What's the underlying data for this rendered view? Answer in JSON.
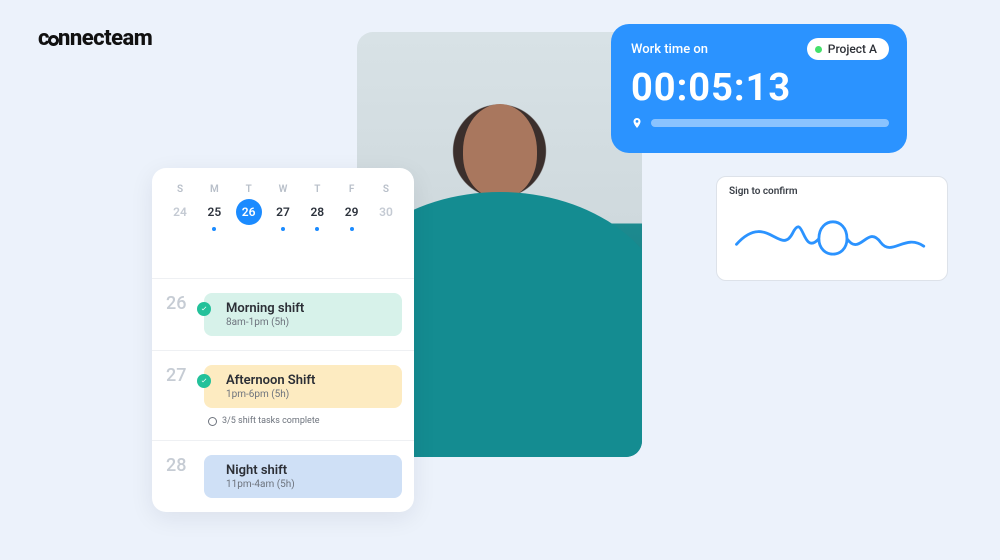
{
  "brand": {
    "name_prefix": "c",
    "name_mid": "nnecteam"
  },
  "calendar": {
    "dow": [
      "S",
      "M",
      "T",
      "W",
      "T",
      "F",
      "S"
    ],
    "days": [
      {
        "num": "24",
        "muted": true,
        "dot": false,
        "selected": false
      },
      {
        "num": "25",
        "muted": false,
        "dot": true,
        "selected": false
      },
      {
        "num": "26",
        "muted": false,
        "dot": true,
        "selected": true
      },
      {
        "num": "27",
        "muted": false,
        "dot": true,
        "selected": false
      },
      {
        "num": "28",
        "muted": false,
        "dot": true,
        "selected": false
      },
      {
        "num": "29",
        "muted": false,
        "dot": true,
        "selected": false
      },
      {
        "num": "30",
        "muted": true,
        "dot": false,
        "selected": false
      }
    ],
    "shifts": [
      {
        "day": "26",
        "title": "Morning shift",
        "sub": "8am-1pm (5h)",
        "variant": "morning",
        "checked": true,
        "tasks": null
      },
      {
        "day": "27",
        "title": "Afternoon Shift",
        "sub": "1pm-6pm (5h)",
        "variant": "afternoon",
        "checked": true,
        "tasks": "3/5 shift tasks complete"
      },
      {
        "day": "28",
        "title": "Night shift",
        "sub": "11pm-4am (5h)",
        "variant": "night",
        "checked": false,
        "tasks": null
      }
    ]
  },
  "timer": {
    "label": "Work time on",
    "project": "Project A",
    "time": "00:05:13"
  },
  "signature": {
    "label": "Sign to confirm"
  }
}
